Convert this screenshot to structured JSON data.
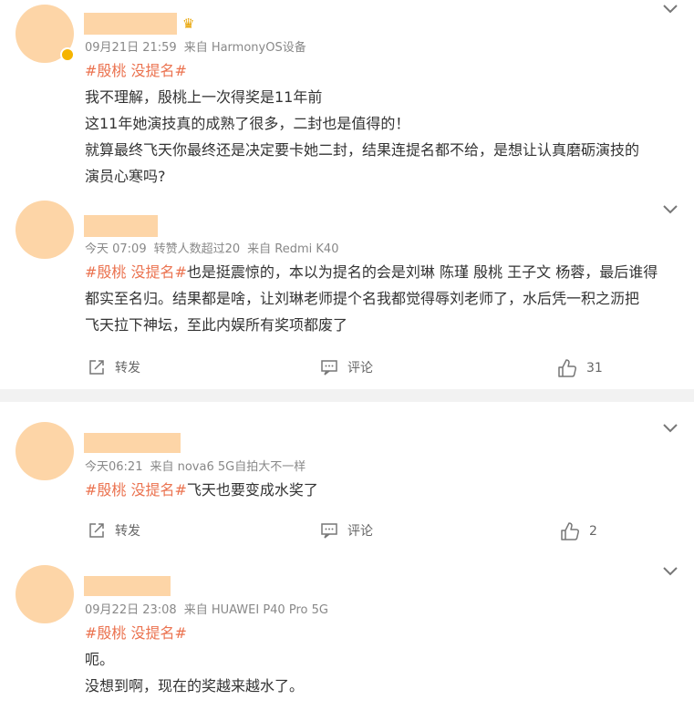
{
  "comments": [
    {
      "date": "09月21日 21:59",
      "source": "来自 HarmonyOS设备",
      "topic": "#殷桃 没提名#",
      "lines": [
        "我不理解，殷桃上一次得奖是11年前",
        "这11年她演技真的成熟了很多，二封也是值得的！",
        "就算最终飞天你最终还是决定要卡她二封，结果连提名都不给，是想让认真磨砺演技的",
        "演员心寒吗?"
      ]
    },
    {
      "date": "今天 07:09",
      "extra": "转赞人数超过20",
      "source": "来自 Redmi K40",
      "topic": "#殷桃 没提名#",
      "line1_rest": "也是挺震惊的，本以为提名的会是刘琳 陈瑾 殷桃 王子文 杨蓉，最后谁得",
      "line2": "都实至名归。结果都是啥，让刘琳老师提个名我都觉得辱刘老师了，水后凭一积之沥把",
      "line3": "飞天拉下神坛，至此内娱所有奖项都废了",
      "repost": "转发",
      "comment": "评论",
      "likes": "31"
    },
    {
      "date": "今天06:21",
      "source": "来自 nova6 5G自拍大不一样",
      "topic": "#殷桃 没提名#",
      "rest": "飞天也要变成水奖了",
      "repost": "转发",
      "comment": "评论",
      "likes": "2"
    },
    {
      "date": "09月22日 23:08",
      "source": "来自 HUAWEI P40 Pro 5G",
      "topic": "#殷桃 没提名#",
      "lines": [
        "呃。",
        "没想到啊，现在的奖越来越水了。"
      ]
    }
  ],
  "colors": {
    "avatar": "#fdd5a7",
    "topic": "#eb7350",
    "meta": "#888888",
    "divider": "#f2f2f2"
  },
  "icons": [
    "chevron-down-icon",
    "repost-icon",
    "comment-icon",
    "like-icon",
    "crown-icon",
    "vip-badge-icon"
  ]
}
